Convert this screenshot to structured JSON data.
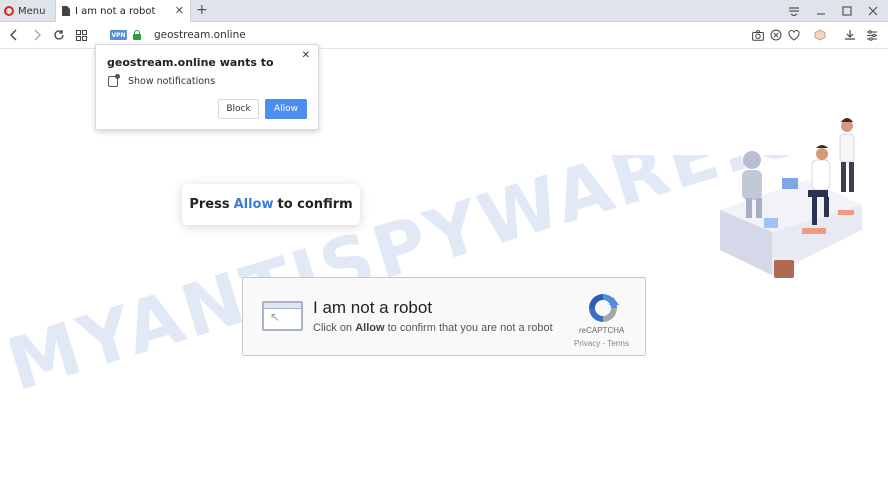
{
  "browser": {
    "menu_label": "Menu",
    "tab_title": "I am not a robot",
    "vpn_badge": "VPN",
    "url": "geostream.online"
  },
  "permission_prompt": {
    "title": "geostream.online wants to",
    "permission": "Show notifications",
    "block_label": "Block",
    "allow_label": "Allow"
  },
  "press_box": {
    "before": "Press",
    "accent": "Allow",
    "after": "to confirm"
  },
  "captcha": {
    "heading": "I am not a robot",
    "sub_before": "Click on",
    "sub_bold": "Allow",
    "sub_after": "to confirm that you are not a robot",
    "brand": "reCAPTCHA",
    "links": "Privacy - Terms"
  },
  "watermark": "MYANTISPYWARE.COM",
  "colors": {
    "accent_blue": "#4a8ef0",
    "opera_red": "#e2231a",
    "lock_green": "#2e9d3b"
  }
}
